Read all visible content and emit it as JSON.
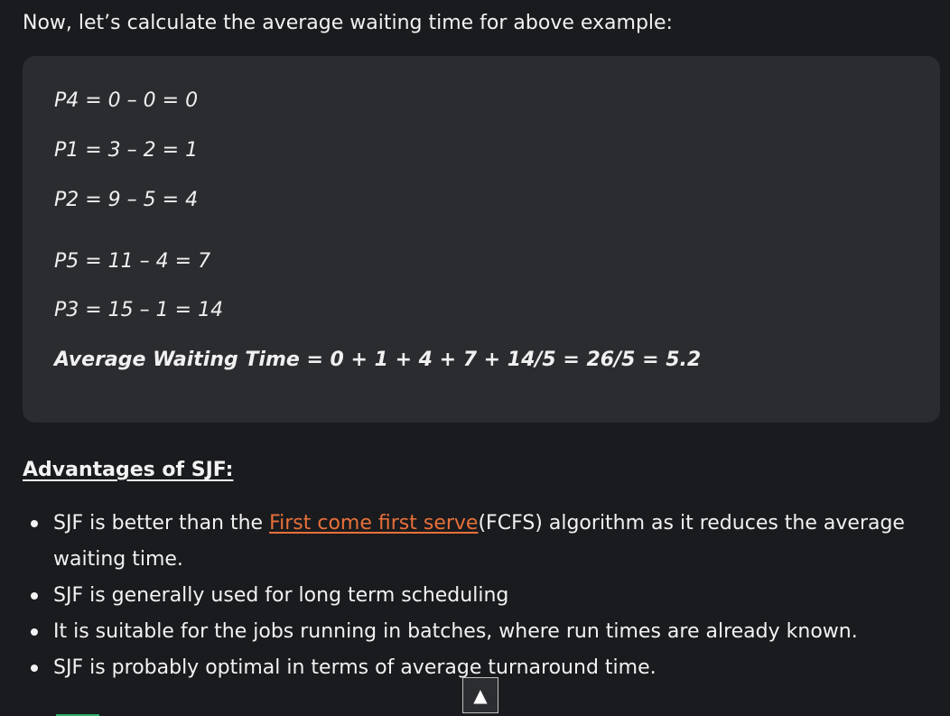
{
  "intro": "Now, let’s calculate the average waiting time for above example:",
  "calculations": [
    "P4 = 0 – 0 = 0",
    "P1 = 3 – 2 = 1",
    "P2 = 9 – 5 = 4",
    "P5 = 11 – 4 = 7",
    "P3 = 15 – 1 = 14"
  ],
  "average": "Average Waiting Time = 0 + 1 + 4 + 7 + 14/5 = 26/5 = 5.2",
  "advantages": {
    "heading": "Advantages of SJF:",
    "item1_before": "SJF is better than the ",
    "item1_link": "First come first serve",
    "item1_after": "(FCFS) algorithm as it reduces the average waiting time.",
    "item2": "SJF is generally used for long term scheduling",
    "item3": "It is suitable for the jobs running in batches, where run times are already known.",
    "item4": "SJF is probably optimal in terms of average turnaround time."
  },
  "scroll_top": {
    "icon": "▲"
  },
  "colors": {
    "background": "#1a1b1e",
    "code_box": "#2b2c30",
    "link": "#e8703a"
  }
}
